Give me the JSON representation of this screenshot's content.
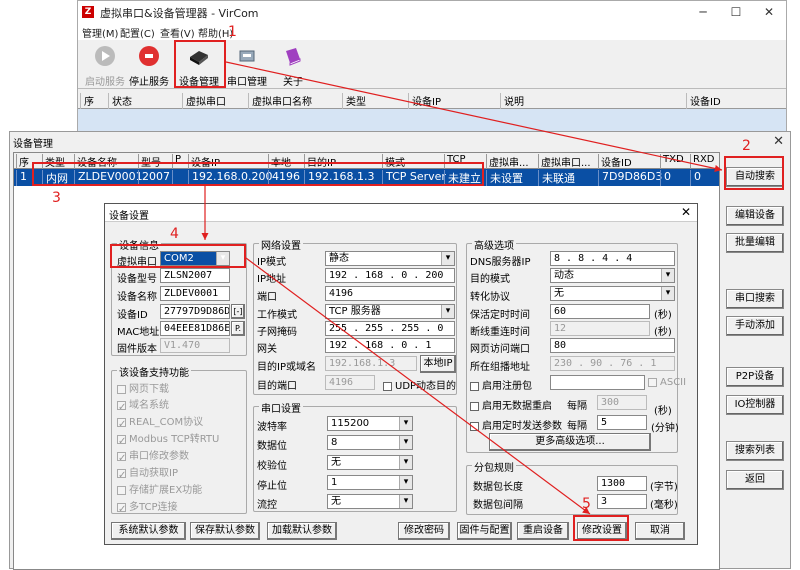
{
  "main_window": {
    "title": "虚拟串口&设备管理器 - VirCom",
    "menu": [
      "管理(M)",
      "配置(C)",
      "查看(V)",
      "帮助(H)"
    ],
    "toolbar": [
      "启动服务",
      "停止服务",
      "设备管理",
      "串口管理",
      "关于"
    ],
    "columns": [
      "序",
      "状态",
      "虚拟串口",
      "虚拟串口名称",
      "类型",
      "设备IP",
      "说明",
      "设备ID"
    ]
  },
  "device_mgmt": {
    "title": "设备管理",
    "columns": [
      "序",
      "类型",
      "设备名称",
      "型号",
      "P",
      "设备IP",
      "本地",
      "目的IP",
      "模式",
      "TCP",
      "虚拟串...",
      "虚拟串口...",
      "设备ID",
      "TXD",
      "RXD"
    ],
    "row": [
      "1",
      "内网",
      "ZLDEV0001",
      "2007",
      "",
      "192.168.0.200",
      "4196",
      "192.168.1.3",
      "TCP Server",
      "未建立",
      "未设置",
      "未联通",
      "7D9D86D3",
      "0",
      "0"
    ],
    "buttons": [
      "自动搜索",
      "编辑设备",
      "批量编辑",
      "串口搜索",
      "手动添加",
      "P2P设备",
      "IO控制器",
      "搜索列表",
      "返回"
    ]
  },
  "settings": {
    "title": "设备设置",
    "device_info": {
      "label": "设备信息",
      "vport_label": "虚拟串口",
      "vport": "COM2",
      "model_label": "设备型号",
      "model": "ZLSN2007",
      "name_label": "设备名称",
      "name": "ZLDEV0001",
      "id_label": "设备ID",
      "id": "27797D9D86D3",
      "id_btn": "[-]",
      "mac_label": "MAC地址",
      "mac": "04EEE81D86EB",
      "mac_btn": "P.",
      "fw_label": "固件版本",
      "fw": "V1.470"
    },
    "features": {
      "label": "该设备支持功能",
      "items": [
        "网页下载",
        "域名系统",
        "REAL_COM协议",
        "Modbus TCP转RTU",
        "串口修改参数",
        "自动获取IP",
        "存储扩展EX功能",
        "多TCP连接"
      ]
    },
    "network": {
      "label": "网络设置",
      "ipmode_label": "IP模式",
      "ipmode": "静态",
      "ip_label": "IP地址",
      "ip": "192 . 168 .  0  . 200",
      "port_label": "端口",
      "port": "4196",
      "workmode_label": "工作模式",
      "workmode": "TCP 服务器",
      "mask_label": "子网掩码",
      "mask": "255 . 255 . 255 .  0",
      "gw_label": "网关",
      "gw": "192 . 168 .  0  .  1",
      "dst_label": "目的IP或域名",
      "dst": "192.168.1.3",
      "local_ip_btn": "本地IP",
      "dport_label": "目的端口",
      "dport": "4196",
      "udp_label": "UDP动态目的"
    },
    "serial": {
      "label": "串口设置",
      "baud_label": "波特率",
      "baud": "115200",
      "data_label": "数据位",
      "data": "8",
      "parity_label": "校验位",
      "parity": "无",
      "stop_label": "停止位",
      "stop": "1",
      "flow_label": "流控",
      "flow": "无"
    },
    "advanced": {
      "label": "高级选项",
      "dns_label": "DNS服务器IP",
      "dns": "8  .  8  .  4  .  4",
      "dstmode_label": "目的模式",
      "dstmode": "动态",
      "proto_label": "转化协议",
      "proto": "无",
      "keepalive_label": "保活定时时间",
      "keepalive": "60",
      "keepalive_unit": "(秒)",
      "reconnect_label": "断线重连时间",
      "reconnect": "12",
      "reconnect_unit": "(秒)",
      "web_label": "网页访问端口",
      "web": "80",
      "mcast_label": "所在组播地址",
      "mcast": "230 . 90 . 76 . 1",
      "reg_label": "启用注册包",
      "ascii_label": "ASCII",
      "nodata_label": "启用无数据重启",
      "every1": "每隔",
      "nodata": "300",
      "nodata_unit": "(秒)",
      "timed_label": "启用定时发送参数",
      "every2": "每隔",
      "timed": "5",
      "timed_unit": "(分钟)",
      "more_btn": "更多高级选项..."
    },
    "packet": {
      "label": "分包规则",
      "len_label": "数据包长度",
      "len": "1300",
      "len_unit": "(字节)",
      "gap_label": "数据包间隔",
      "gap": "3",
      "gap_unit": "(毫秒)"
    },
    "buttons": [
      "系统默认参数",
      "保存默认参数",
      "加载默认参数",
      "修改密码",
      "固件与配置",
      "重启设备",
      "修改设置",
      "取消"
    ]
  },
  "annotations": [
    "1",
    "2",
    "3",
    "4",
    "5"
  ],
  "accent_color": "#e02020"
}
